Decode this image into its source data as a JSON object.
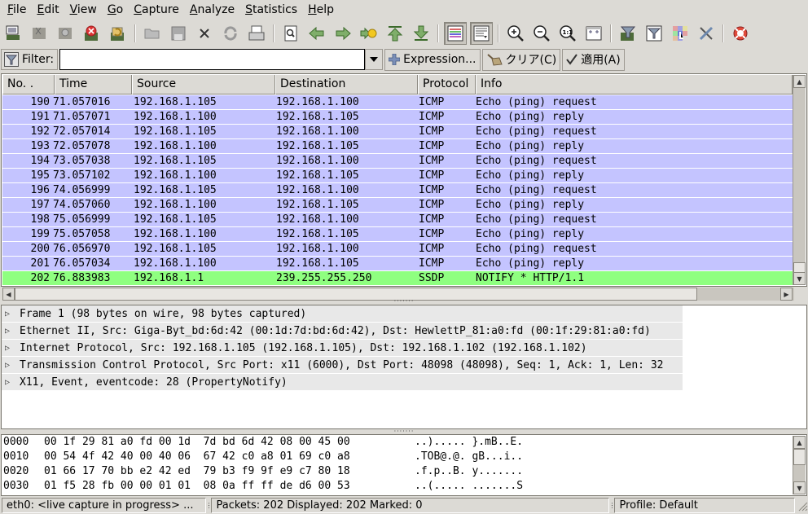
{
  "menu": [
    {
      "label": "File",
      "mnemonic": "F"
    },
    {
      "label": "Edit",
      "mnemonic": "E"
    },
    {
      "label": "View",
      "mnemonic": "V"
    },
    {
      "label": "Go",
      "mnemonic": "G"
    },
    {
      "label": "Capture",
      "mnemonic": "C"
    },
    {
      "label": "Analyze",
      "mnemonic": "A"
    },
    {
      "label": "Statistics",
      "mnemonic": "S"
    },
    {
      "label": "Help",
      "mnemonic": "H"
    }
  ],
  "toolbar": {
    "icons": [
      "capture-interfaces-icon",
      "capture-options-icon",
      "capture-start-icon",
      "capture-stop-icon",
      "capture-restart-icon",
      "open-file-icon",
      "save-file-icon",
      "close-file-icon",
      "reload-icon",
      "print-icon",
      "find-packet-icon",
      "go-back-icon",
      "go-forward-icon",
      "go-to-packet-icon",
      "go-first-icon",
      "go-last-icon",
      "colorize-icon",
      "auto-scroll-icon",
      "zoom-in-icon",
      "zoom-out-icon",
      "zoom-normal-icon",
      "resize-columns-icon",
      "capture-filter-icon",
      "display-filter-icon",
      "coloring-rules-icon",
      "preferences-icon",
      "help-icon"
    ]
  },
  "filterbar": {
    "filter_label": "Filter:",
    "filter_value": "",
    "expression_label": "Expression...",
    "clear_label": "クリア(C)",
    "apply_label": "適用(A)"
  },
  "packet_list": {
    "columns": [
      "No. .",
      "Time",
      "Source",
      "Destination",
      "Protocol",
      "Info"
    ],
    "rows": [
      {
        "no": "190",
        "time": "71.057016",
        "src": "192.168.1.105",
        "dst": "192.168.1.100",
        "proto": "ICMP",
        "info": "Echo (ping) request"
      },
      {
        "no": "191",
        "time": "71.057071",
        "src": "192.168.1.100",
        "dst": "192.168.1.105",
        "proto": "ICMP",
        "info": "Echo (ping) reply"
      },
      {
        "no": "192",
        "time": "72.057014",
        "src": "192.168.1.105",
        "dst": "192.168.1.100",
        "proto": "ICMP",
        "info": "Echo (ping) request"
      },
      {
        "no": "193",
        "time": "72.057078",
        "src": "192.168.1.100",
        "dst": "192.168.1.105",
        "proto": "ICMP",
        "info": "Echo (ping) reply"
      },
      {
        "no": "194",
        "time": "73.057038",
        "src": "192.168.1.105",
        "dst": "192.168.1.100",
        "proto": "ICMP",
        "info": "Echo (ping) request"
      },
      {
        "no": "195",
        "time": "73.057102",
        "src": "192.168.1.100",
        "dst": "192.168.1.105",
        "proto": "ICMP",
        "info": "Echo (ping) reply"
      },
      {
        "no": "196",
        "time": "74.056999",
        "src": "192.168.1.105",
        "dst": "192.168.1.100",
        "proto": "ICMP",
        "info": "Echo (ping) request"
      },
      {
        "no": "197",
        "time": "74.057060",
        "src": "192.168.1.100",
        "dst": "192.168.1.105",
        "proto": "ICMP",
        "info": "Echo (ping) reply"
      },
      {
        "no": "198",
        "time": "75.056999",
        "src": "192.168.1.105",
        "dst": "192.168.1.100",
        "proto": "ICMP",
        "info": "Echo (ping) request"
      },
      {
        "no": "199",
        "time": "75.057058",
        "src": "192.168.1.100",
        "dst": "192.168.1.105",
        "proto": "ICMP",
        "info": "Echo (ping) reply"
      },
      {
        "no": "200",
        "time": "76.056970",
        "src": "192.168.1.105",
        "dst": "192.168.1.100",
        "proto": "ICMP",
        "info": "Echo (ping) request"
      },
      {
        "no": "201",
        "time": "76.057034",
        "src": "192.168.1.100",
        "dst": "192.168.1.105",
        "proto": "ICMP",
        "info": "Echo (ping) reply"
      },
      {
        "no": "202",
        "time": "76.883983",
        "src": "192.168.1.1",
        "dst": "239.255.255.250",
        "proto": "SSDP",
        "info": "NOTIFY * HTTP/1.1"
      }
    ],
    "colors": {
      "icmp": "#c4c4ff",
      "ssdp": "#8fff80"
    }
  },
  "details": [
    "Frame 1 (98 bytes on wire, 98 bytes captured)",
    "Ethernet II, Src: Giga-Byt_bd:6d:42 (00:1d:7d:bd:6d:42), Dst: HewlettP_81:a0:fd (00:1f:29:81:a0:fd)",
    "Internet Protocol, Src: 192.168.1.105 (192.168.1.105), Dst: 192.168.1.102 (192.168.1.102)",
    "Transmission Control Protocol, Src Port: x11 (6000), Dst Port: 48098 (48098), Seq: 1, Ack: 1, Len: 32",
    "X11, Event, eventcode: 28 (PropertyNotify)"
  ],
  "bytes": [
    {
      "offset": "0000",
      "hex": "00 1f 29 81 a0 fd 00 1d  7d bd 6d 42 08 00 45 00",
      "ascii": "..)..... }.mB..E."
    },
    {
      "offset": "0010",
      "hex": "00 54 4f 42 40 00 40 06  67 42 c0 a8 01 69 c0 a8",
      "ascii": ".TOB@.@. gB...i.."
    },
    {
      "offset": "0020",
      "hex": "01 66 17 70 bb e2 42 ed  79 b3 f9 9f e9 c7 80 18",
      "ascii": ".f.p..B. y......."
    },
    {
      "offset": "0030",
      "hex": "01 f5 28 fb 00 00 01 01  08 0a ff ff de d6 00 53",
      "ascii": "..(..... .......S"
    }
  ],
  "status": {
    "capture": "eth0: <live capture in progress> ...",
    "packets": "Packets: 202 Displayed: 202 Marked: 0",
    "profile": "Profile: Default"
  }
}
